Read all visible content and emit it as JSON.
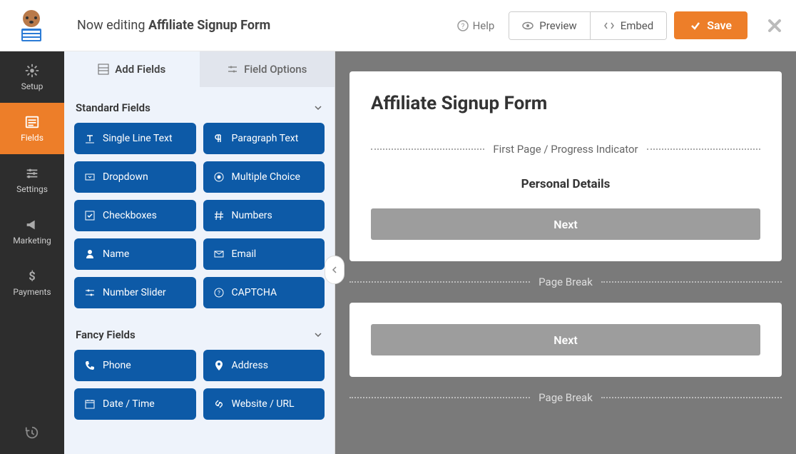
{
  "header": {
    "editing_prefix": "Now editing ",
    "form_name": "Affiliate Signup Form",
    "help": "Help",
    "preview": "Preview",
    "embed": "Embed",
    "save": "Save"
  },
  "leftnav": {
    "setup": "Setup",
    "fields": "Fields",
    "settings": "Settings",
    "marketing": "Marketing",
    "payments": "Payments"
  },
  "panel": {
    "tab_add": "Add Fields",
    "tab_options": "Field Options",
    "standard_label": "Standard Fields",
    "fancy_label": "Fancy Fields",
    "standard": [
      "Single Line Text",
      "Paragraph Text",
      "Dropdown",
      "Multiple Choice",
      "Checkboxes",
      "Numbers",
      "Name",
      "Email",
      "Number Slider",
      "CAPTCHA"
    ],
    "fancy": [
      "Phone",
      "Address",
      "Date / Time",
      "Website / URL"
    ]
  },
  "form": {
    "title": "Affiliate Signup Form",
    "progress_label": "First Page / Progress Indicator",
    "section1_title": "Personal Details",
    "next": "Next",
    "page_break": "Page Break"
  }
}
